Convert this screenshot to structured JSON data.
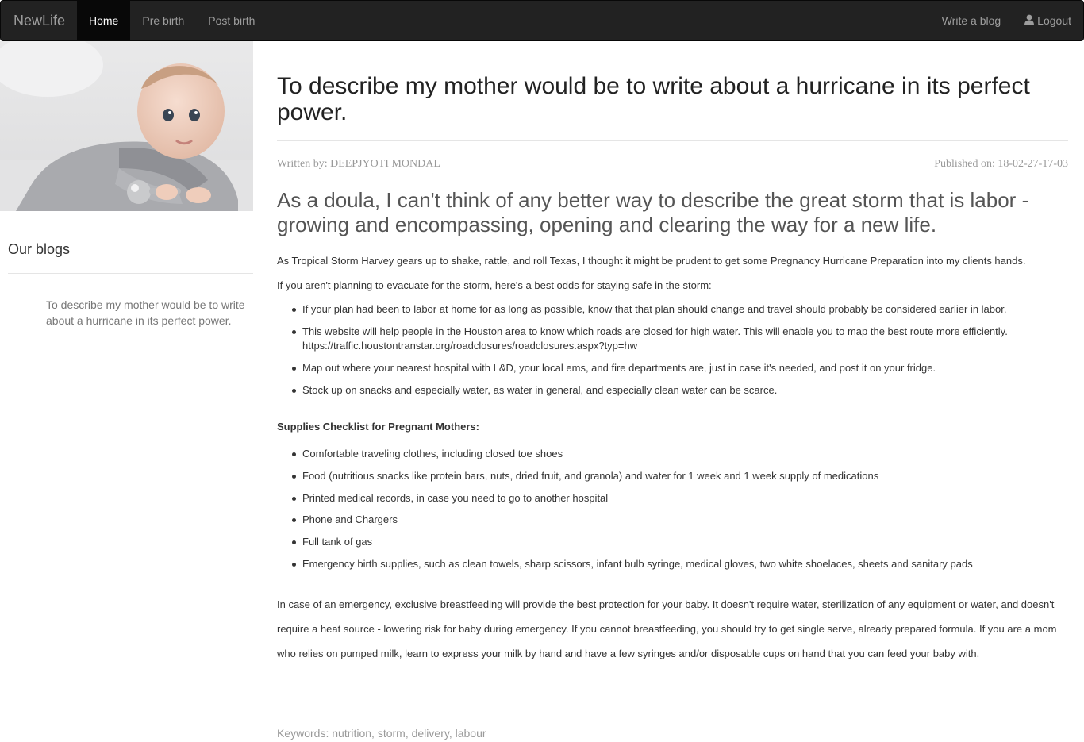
{
  "navbar": {
    "brand": "NewLife",
    "items": [
      {
        "label": "Home",
        "active": true
      },
      {
        "label": "Pre birth",
        "active": false
      },
      {
        "label": "Post birth",
        "active": false
      }
    ],
    "right": {
      "write_label": "Write a blog",
      "logout_label": "Logout",
      "logout_icon": "user-icon"
    }
  },
  "sidebar": {
    "image_alt": "baby-photo",
    "title": "Our blogs",
    "links": [
      "To describe my mother would be to write about a hurricane in its perfect power."
    ]
  },
  "article": {
    "title": "To describe my mother would be to write about a hurricane in its perfect power.",
    "author": "Written by: DEEPJYOTI MONDAL",
    "published": "Published on: 18-02-27-17-03",
    "lead": "As a doula, I can't think of any better way to describe the great storm that is labor - growing and encompassing, opening and clearing the way for a new life.",
    "para1": "As Tropical Storm Harvey gears up to shake, rattle, and roll Texas, I thought it might be prudent to get some Pregnancy Hurricane Preparation into my clients hands.",
    "para2": "If you aren't planning to evacuate for the storm, here's a best odds for staying safe in the storm:",
    "tips": [
      "If your plan had been to labor at home for as long as possible, know that that plan should change and travel should probably be considered earlier in labor.",
      "This website will help people in the Houston area to know which roads are closed for high water. This will enable you to map the best route more efficiently. https://traffic.houstontranstar.org/roadclosures/roadclosures.aspx?typ=hw",
      "Map out where your nearest hospital with L&D, your local ems, and fire departments are, just in case it's needed, and post it on your fridge.",
      "Stock up on snacks and especially water, as water in general, and especially clean water can be scarce."
    ],
    "supplies_heading": "Supplies Checklist for Pregnant Mothers:",
    "supplies": [
      "Comfortable traveling clothes, including closed toe shoes",
      "Food (nutritious snacks like protein bars, nuts, dried fruit, and granola) and water for 1 week and 1 week supply of medications",
      "Printed medical records, in case you need to go to another hospital",
      "Phone and Chargers",
      "Full tank of gas",
      "Emergency birth supplies, such as clean towels, sharp scissors, infant bulb syringe, medical gloves, two white shoelaces, sheets and sanitary pads"
    ],
    "closing": "In case of an emergency, exclusive breastfeeding will provide the best protection for your baby. It doesn't require water, sterilization of any equipment or water, and doesn't require a heat source - lowering risk for baby during emergency. If you cannot breastfeeding, you should try to get single serve, already prepared formula. If you are a mom who relies on pumped milk, learn to express your milk by hand and have a few syringes and/or disposable cups on hand that you can feed your baby with.",
    "keywords": "Keywords: nutrition, storm, delivery, labour"
  }
}
